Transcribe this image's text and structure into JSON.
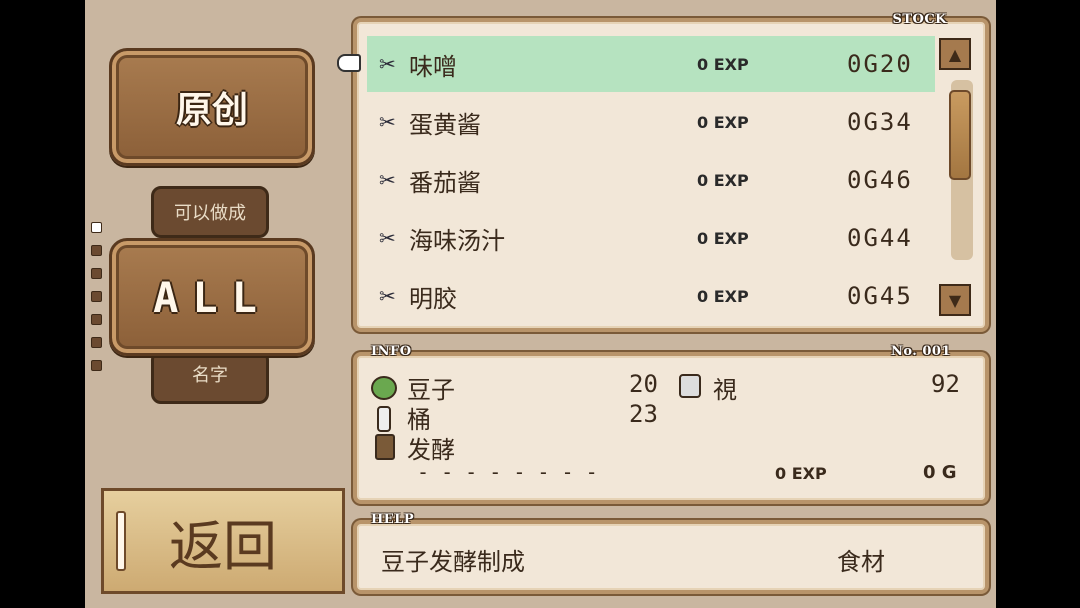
{
  "mode_button": {
    "label": "原创"
  },
  "filter": {
    "top_label": "可以做成",
    "value": "ALL",
    "bottom_label": "名字"
  },
  "stock": {
    "tag": "STOCK",
    "items": [
      {
        "name": "味噌",
        "exp": "0 EXP",
        "gold": "0G20"
      },
      {
        "name": "蛋黄酱",
        "exp": "0 EXP",
        "gold": "0G34"
      },
      {
        "name": "番茄酱",
        "exp": "0 EXP",
        "gold": "0G46"
      },
      {
        "name": "海味汤汁",
        "exp": "0 EXP",
        "gold": "0G44"
      },
      {
        "name": "明胶",
        "exp": "0 EXP",
        "gold": "0G45"
      }
    ]
  },
  "info": {
    "tag": "INFO",
    "number": "No. 001",
    "ingredients": [
      {
        "name": "豆子",
        "qty": "20"
      },
      {
        "name": "桶",
        "qty": "23"
      },
      {
        "name": "发酵",
        "qty": ""
      }
    ],
    "stat_label": "視",
    "stat_value": "92",
    "dashes": "- - - - - - - -",
    "exp": "0 EXP",
    "gold": "0 G"
  },
  "help": {
    "tag": "HELP",
    "text": "豆子发酵制成",
    "category": "食材"
  },
  "return_button": {
    "label": "返回"
  },
  "colors": {
    "selected_row": "#b6e3c0",
    "panel_bg": "#f2e7d8",
    "screen_bg": "#c9b6a0"
  }
}
